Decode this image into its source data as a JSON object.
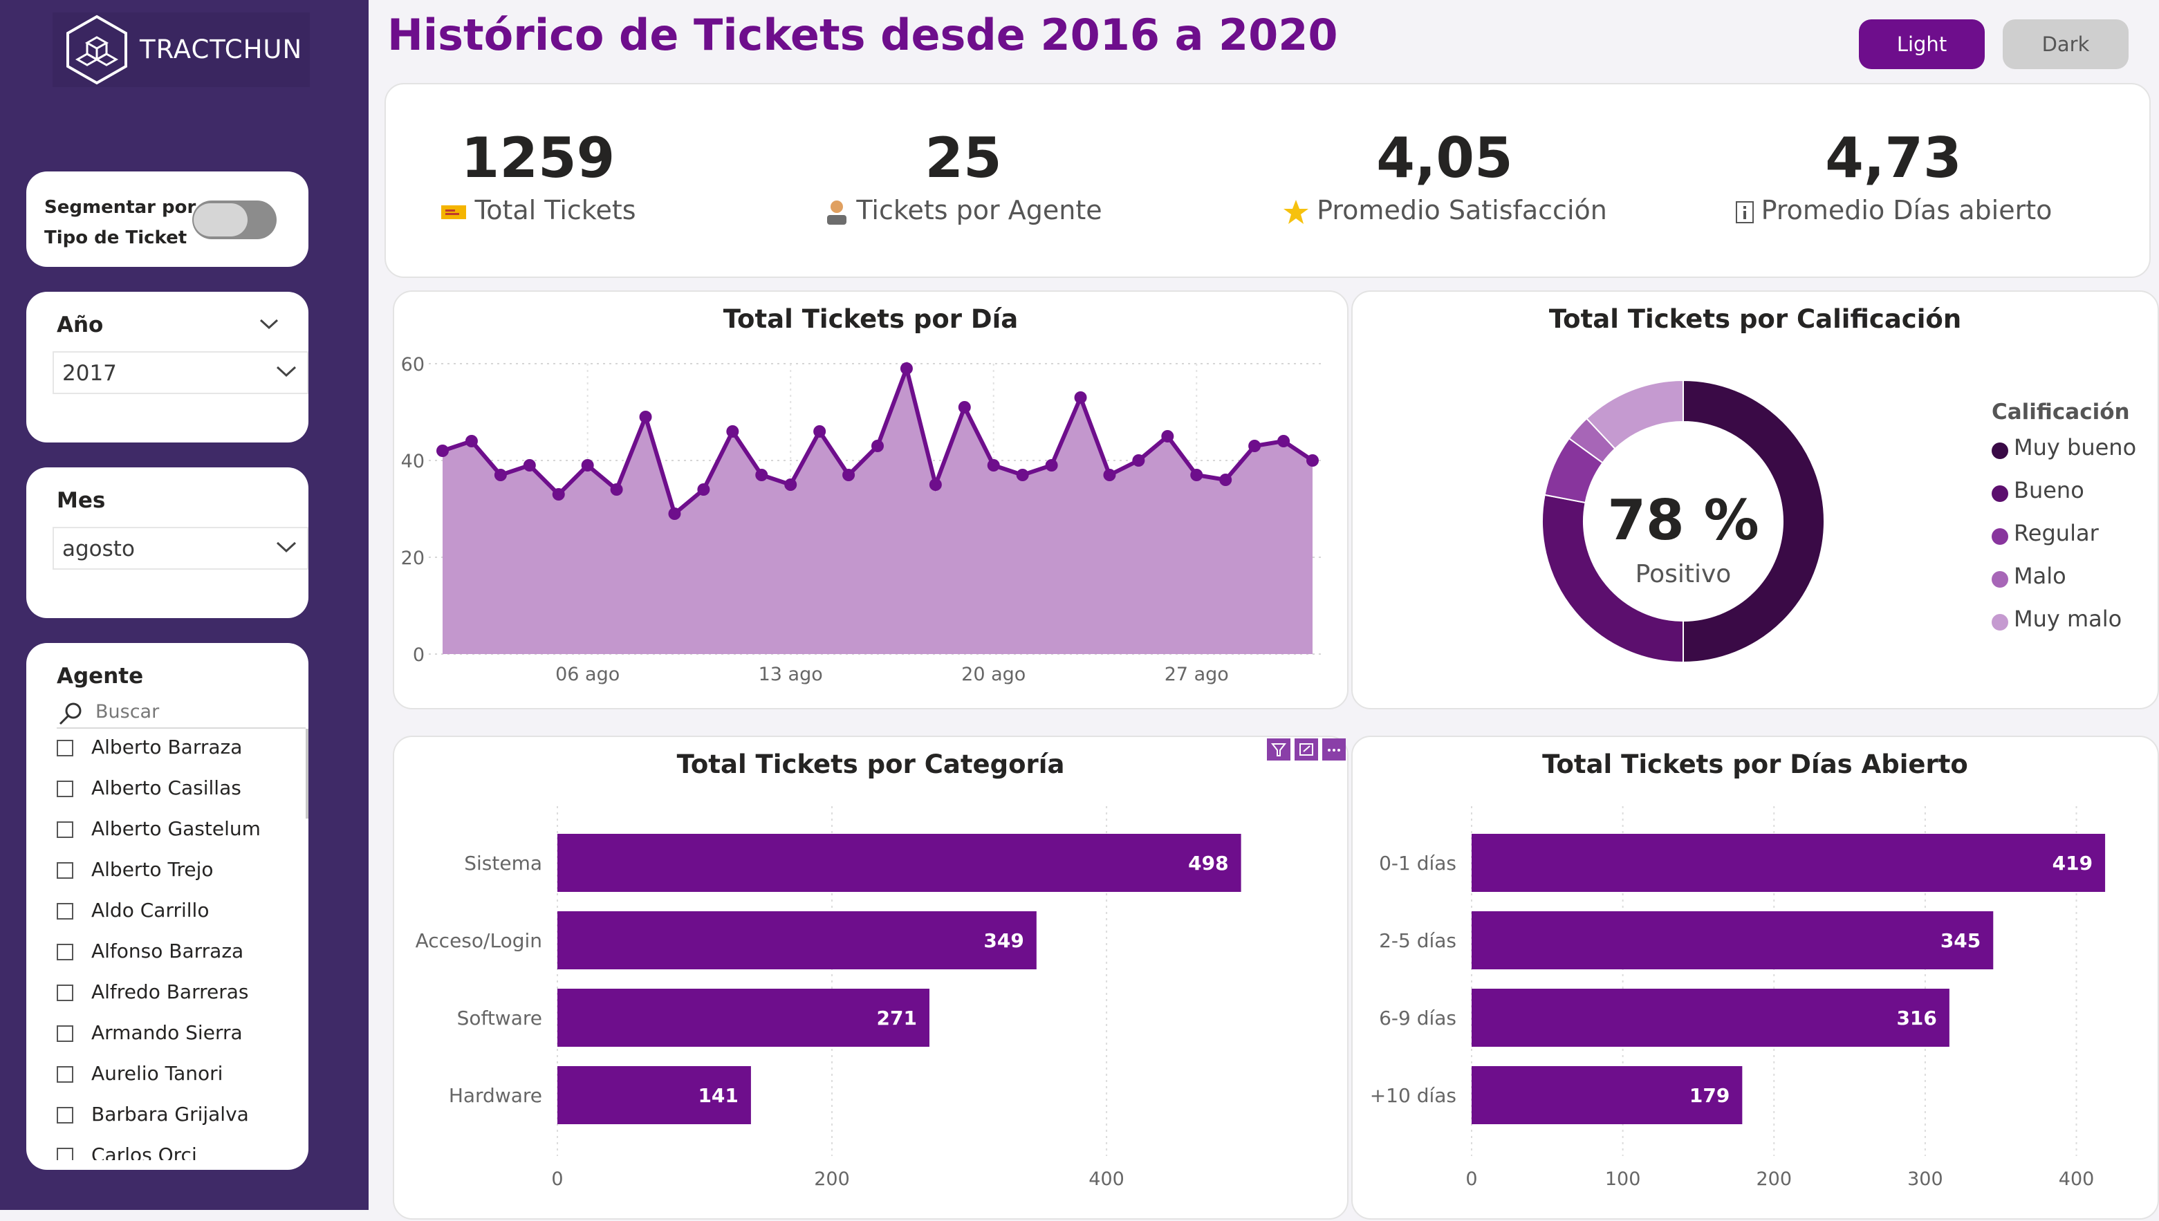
{
  "brand": {
    "name": "TRACTCHUN"
  },
  "header": {
    "title": "Histórico de Tickets desde 2016 a 2020"
  },
  "theme_buttons": {
    "light": "Light",
    "dark": "Dark"
  },
  "colors": {
    "accent": "#6e0e8c",
    "sidebar": "#3f2a67",
    "area_fill": "#c397cd"
  },
  "filters": {
    "segment": {
      "label_line1": "Segmentar por",
      "label_line2": "Tipo de Ticket",
      "enabled": false
    },
    "year": {
      "title": "Año",
      "value": "2017"
    },
    "month": {
      "title": "Mes",
      "value": "agosto"
    },
    "agent": {
      "title": "Agente",
      "search_placeholder": "Buscar",
      "items": [
        "Alberto Barraza",
        "Alberto Casillas",
        "Alberto Gastelum",
        "Alberto Trejo",
        "Aldo Carrillo",
        "Alfonso Barraza",
        "Alfredo Barreras",
        "Armando Sierra",
        "Aurelio Tanori",
        "Barbara Grijalva",
        "Carlos Orci"
      ]
    }
  },
  "kpis": [
    {
      "value": "1259",
      "label": "Total Tickets",
      "icon": "ticket-icon"
    },
    {
      "value": "25",
      "label": "Tickets por Agente",
      "icon": "agent-icon"
    },
    {
      "value": "4,05",
      "label": "Promedio Satisfacción",
      "icon": "star-icon"
    },
    {
      "value": "4,73",
      "label": "Promedio Días abierto",
      "icon": "info-icon"
    }
  ],
  "chart_data": [
    {
      "type": "area",
      "title": "Total Tickets por Día",
      "x": [
        "01 ago",
        "02 ago",
        "03 ago",
        "04 ago",
        "05 ago",
        "06 ago",
        "07 ago",
        "08 ago",
        "09 ago",
        "10 ago",
        "11 ago",
        "12 ago",
        "13 ago",
        "14 ago",
        "15 ago",
        "16 ago",
        "17 ago",
        "18 ago",
        "19 ago",
        "20 ago",
        "21 ago",
        "22 ago",
        "23 ago",
        "24 ago",
        "25 ago",
        "26 ago",
        "27 ago",
        "28 ago",
        "29 ago",
        "30 ago",
        "31 ago"
      ],
      "values": [
        42,
        44,
        37,
        39,
        33,
        39,
        34,
        49,
        29,
        34,
        46,
        37,
        35,
        46,
        37,
        43,
        59,
        35,
        51,
        39,
        37,
        39,
        53,
        37,
        40,
        45,
        37,
        36,
        43,
        44,
        40
      ],
      "xticks": [
        "06 ago",
        "13 ago",
        "20 ago",
        "27 ago"
      ],
      "yticks": [
        0,
        20,
        40,
        60
      ],
      "ylim": [
        0,
        60
      ],
      "grid": true
    },
    {
      "type": "pie",
      "title": "Total Tickets por Calificación",
      "center_value": "78 %",
      "center_label": "Positivo",
      "legend_title": "Calificación",
      "categories": [
        "Muy bueno",
        "Bueno",
        "Regular",
        "Malo",
        "Muy malo"
      ],
      "values": [
        50,
        28,
        7,
        3,
        12
      ],
      "colors": [
        "#3a0a46",
        "#5c0f6e",
        "#88359d",
        "#a766b7",
        "#c59ad0"
      ],
      "legend_position": "right"
    },
    {
      "type": "bar",
      "title": "Total Tickets por Categoría",
      "categories": [
        "Sistema",
        "Acceso/Login",
        "Software",
        "Hardware"
      ],
      "values": [
        498,
        349,
        271,
        141
      ],
      "xticks": [
        0,
        200,
        400
      ],
      "xlim": [
        0,
        540
      ],
      "orientation": "horizontal"
    },
    {
      "type": "bar",
      "title": "Total Tickets por Días Abierto",
      "categories": [
        "0-1 días",
        "2-5 días",
        "6-9 días",
        "+10 días"
      ],
      "values": [
        419,
        345,
        316,
        179
      ],
      "xticks": [
        0,
        100,
        200,
        300,
        400
      ],
      "xlim": [
        0,
        440
      ],
      "orientation": "horizontal"
    }
  ]
}
